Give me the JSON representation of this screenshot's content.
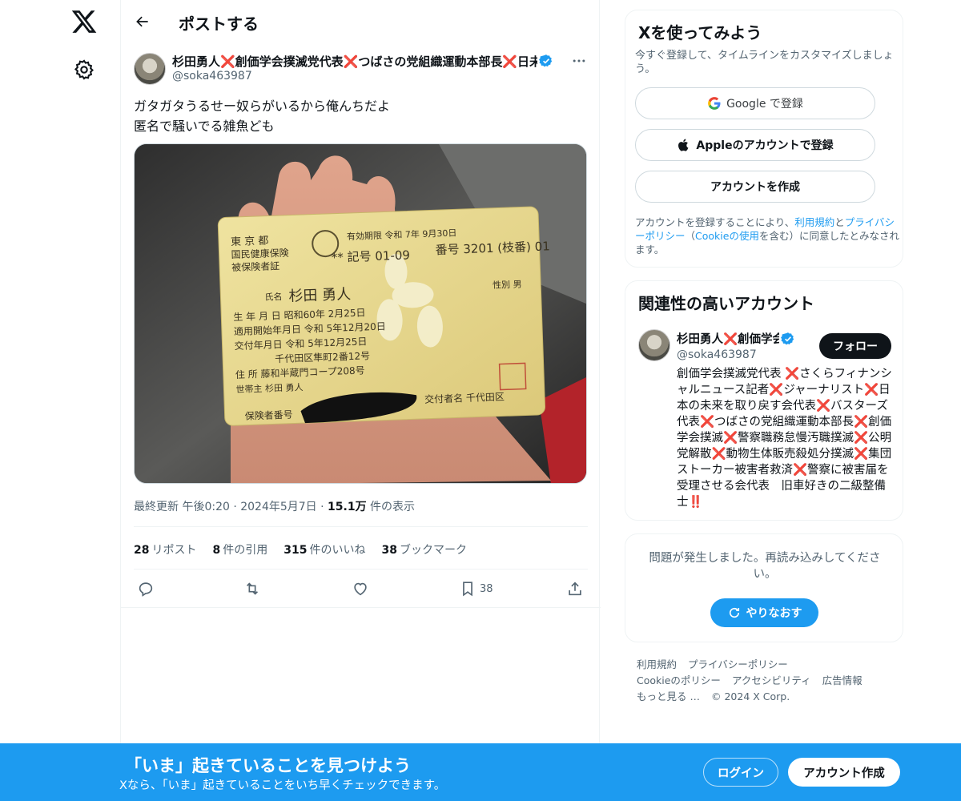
{
  "nav": {
    "logo_icon": "x-logo-icon",
    "settings_icon": "gear-icon"
  },
  "header": {
    "title": "ポストする"
  },
  "post": {
    "author_name": "杉田勇人❌創価学会撲滅党代表❌つばさの党組織運動本部長❌日未来",
    "author_handle": "@soka463987",
    "text": "ガタガタうるせー奴らがいるから俺んちだよ\n匿名で騒いでる雑魚ども",
    "meta_prefix": "最終更新 午後0:20 · 2024年5月7日 · ",
    "views_count": "15.1万",
    "views_label": " 件の表示",
    "stats": {
      "reposts_count": "28",
      "reposts_label": "リポスト",
      "quotes_count": "8",
      "quotes_label": "件の引用",
      "likes_count": "315",
      "likes_label": "件のいいね",
      "bookmarks_count": "38",
      "bookmarks_label": "ブックマーク"
    },
    "bookmark_action_count": "38"
  },
  "card": {
    "line1": "東 京 都",
    "line2": "国民健康保険",
    "line3": "被保険者証",
    "validity": "有効期限  令和  7年  9月30日",
    "kigo": "** 記号 01-09",
    "bango": "番号 3201 (枝番) 01",
    "name_label": "氏名",
    "name": "杉田  勇人",
    "sex": "性別  男",
    "birth": "生 年 月 日   昭和60年  2月25日",
    "apply": "適用開始年月日   令和  5年12月20日",
    "issue": "交付年月日   令和  5年12月25日",
    "address1": "千代田区隼町2番12号",
    "address2": "住 所   藤和半蔵門コープ208号",
    "head": "世帯主    杉田  勇人",
    "insurer": "保険者番号",
    "issuer": "交付者名  千代田区"
  },
  "signup_card": {
    "title": "Xを使ってみよう",
    "subtitle": "今すぐ登録して、タイムラインをカスタマイズしましょう。",
    "google_label": "Google で登録",
    "apple_label": "Appleのアカウントで登録",
    "create_label": "アカウントを作成",
    "legal_1": "アカウントを登録することにより、",
    "legal_terms": "利用規約",
    "legal_2": "と",
    "legal_privacy": "プライバシーポリシー",
    "legal_3": "（",
    "legal_cookie": "Cookieの使用",
    "legal_4": "を含む）に同意したとみなされます。"
  },
  "related_card": {
    "title": "関連性の高いアカウント",
    "name": "杉田勇人❌創価学会撲",
    "handle": "@soka463987",
    "follow_label": "フォロー",
    "bio": "創価学会撲滅党代表 ❌さくらフィナンシャルニュース記者❌ジャーナリスト❌日本の未来を取り戻す会代表❌バスターズ代表❌つばさの党組織運動本部長❌創価学会撲滅❌警察職務怠慢汚職撲滅❌公明党解散❌動物生体販売殺処分撲滅❌集団ストーカー被害者救済❌警察に被害届を受理させる会代表　旧車好きの二級整備士‼️"
  },
  "error_card": {
    "text": "問題が発生しました。再読み込みしてください。",
    "retry_label": "やりなおす"
  },
  "footer": {
    "links": [
      "利用規約",
      "プライバシーポリシー",
      "Cookieのポリシー",
      "アクセシビリティ",
      "広告情報",
      "もっと見る …",
      "© 2024 X Corp."
    ]
  },
  "banner": {
    "title": "「いま」起きていることを見つけよう",
    "subtitle": "Xなら、「いま」起きていることをいち早くチェックできます。",
    "login_label": "ログイン",
    "signup_label": "アカウント作成"
  },
  "colors": {
    "accent": "#1d9bf0",
    "text": "#0f1419",
    "muted": "#536471",
    "banner": "#1d9bf0"
  }
}
